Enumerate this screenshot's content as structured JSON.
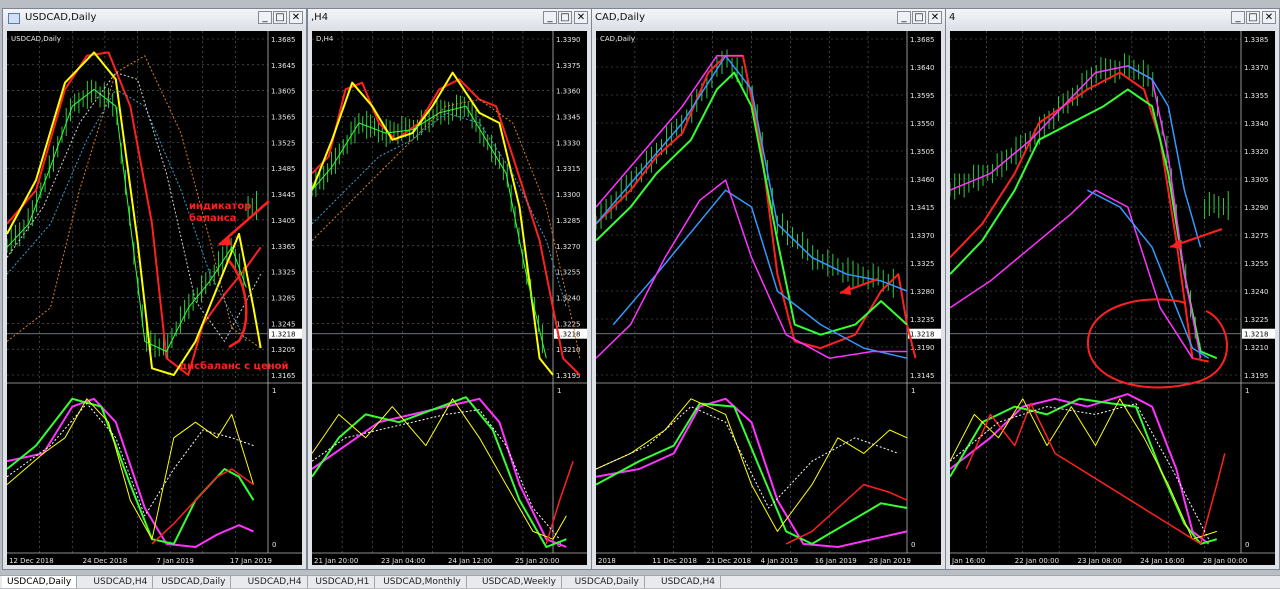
{
  "windows": [
    {
      "title": "USDCAD,Daily",
      "sub_label": "USDCAD,Daily",
      "price_labels": [
        "1.3685",
        "1.3645",
        "1.3605",
        "1.3565",
        "1.3525",
        "1.3485",
        "1.3445",
        "1.3405",
        "1.3365",
        "1.3325",
        "1.3285",
        "1.3245",
        "1.3205",
        "1.3165"
      ],
      "current_price": "1.3218",
      "indicator_labels": [
        "1",
        "0"
      ],
      "date_labels": [
        "12 Dec 2018",
        "24 Dec 2018",
        "7 Jan 2019",
        "17 Jan 2019"
      ]
    },
    {
      "title": ",H4",
      "sub_label": "D,H4",
      "price_labels": [
        "1.3390",
        "1.3375",
        "1.3360",
        "1.3345",
        "1.3330",
        "1.3315",
        "1.3300",
        "1.3285",
        "1.3270",
        "1.3255",
        "1.3240",
        "1.3225",
        "1.3210",
        "1.3195"
      ],
      "current_price": "1.3218",
      "indicator_labels": [
        "1",
        "0"
      ],
      "date_labels": [
        "21 Jan 20:00",
        "23 Jan 04:00",
        "24 Jan 12:00",
        "25 Jan 20:00"
      ]
    },
    {
      "title": "CAD,Daily",
      "sub_label": "CAD,Daily",
      "price_labels": [
        "1.3685",
        "1.3640",
        "1.3595",
        "1.3550",
        "1.3505",
        "1.3460",
        "1.3415",
        "1.3370",
        "1.3325",
        "1.3280",
        "1.3235",
        "1.3190",
        "1.3145"
      ],
      "current_price": "1.3218",
      "indicator_labels": [
        "1",
        "0"
      ],
      "date_labels": [
        "2018",
        "11 Dec 2018",
        "21 Dec 2018",
        "4 Jan 2019",
        "16 Jan 2019",
        "28 Jan 2019"
      ]
    },
    {
      "title": "4",
      "sub_label": "",
      "price_labels": [
        "1.3385",
        "1.3370",
        "1.3355",
        "1.3340",
        "1.3320",
        "1.3305",
        "1.3290",
        "1.3275",
        "1.3255",
        "1.3240",
        "1.3225",
        "1.3210",
        "1.3195"
      ],
      "current_price": "1.3218",
      "indicator_labels": [
        "1",
        "0"
      ],
      "date_labels": [
        "Jan 16:00",
        "22 Jan 00:00",
        "23 Jan 08:00",
        "24 Jan 16:00",
        "28 Jan 00:00"
      ]
    }
  ],
  "annotations": {
    "balance_indicator": "индикатор\nбаланса",
    "price_imbalance": "дисбаланс с ценой"
  },
  "tabs": [
    "USDCAD,Daily",
    "USDCAD,H4",
    "USDCAD,Daily",
    "USDCAD,H4",
    "USDCAD,H1",
    "USDCAD,Monthly",
    "USDCAD,Weekly",
    "USDCAD,Daily",
    "USDCAD,H4"
  ],
  "window_buttons": {
    "minimize": "_",
    "maximize": "□",
    "close": "✕"
  },
  "colors": {
    "background": "#000000",
    "grid": "#6a6a6a",
    "fast_line": "#ffff00",
    "slow_line": "#ff2020",
    "magenta": "#ff33ff",
    "blue": "#3399ff",
    "green": "#33ff33",
    "annotation": "#ff2020"
  }
}
